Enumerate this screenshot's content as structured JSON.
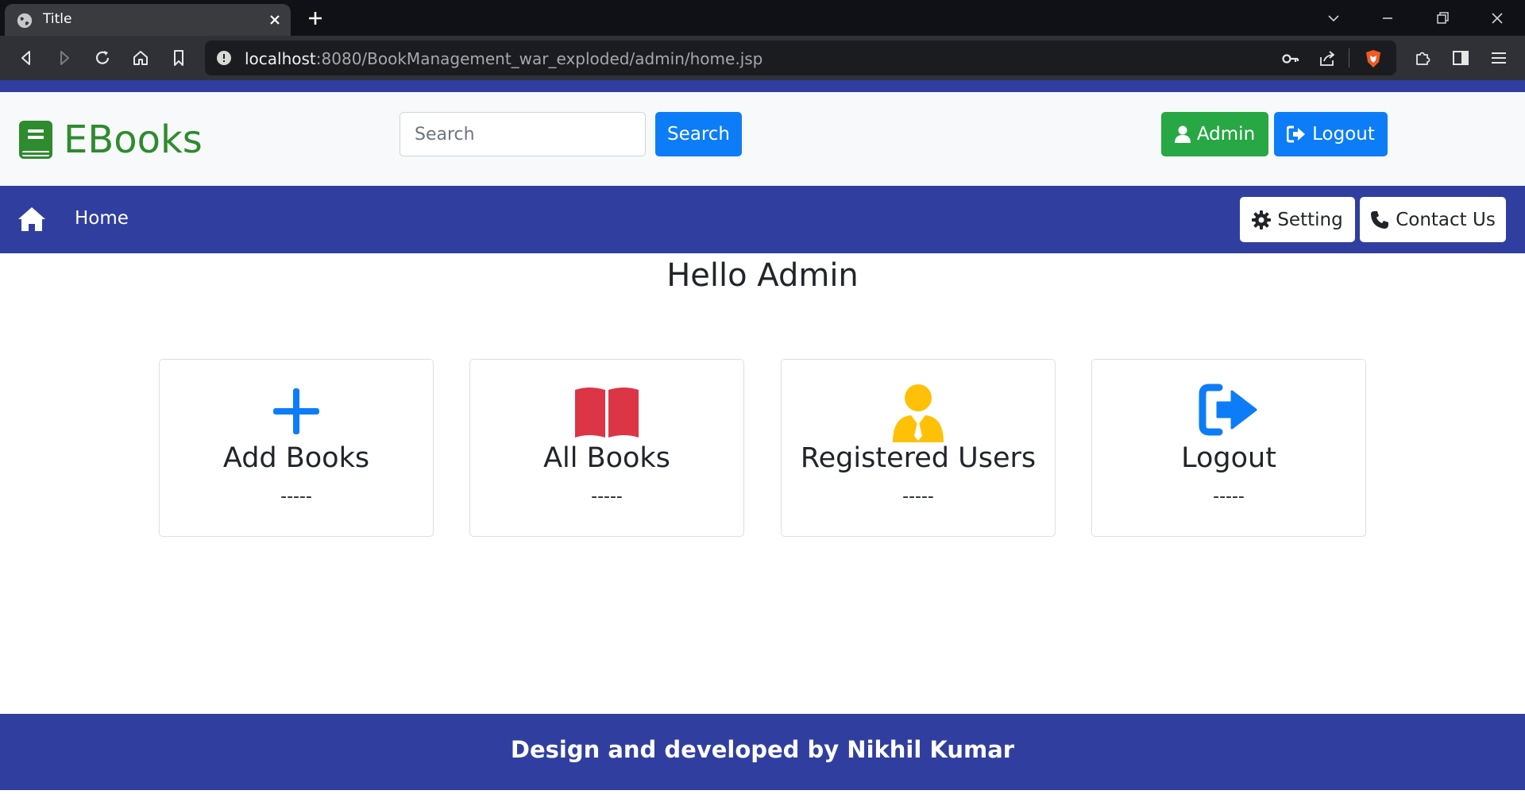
{
  "browser": {
    "tab_title": "Title",
    "url_host": "localhost",
    "url_rest": ":8080/BookManagement_war_exploded/admin/home.jsp",
    "icons": [
      "globe-icon",
      "close-icon",
      "plus-icon",
      "chevron-down-icon",
      "minimize-icon",
      "restore-icon",
      "window-close-icon",
      "back-icon",
      "forward-icon",
      "reload-icon",
      "home-icon",
      "bookmark-icon",
      "info-icon",
      "key-icon",
      "share-icon",
      "brave-shield-icon",
      "extensions-icon",
      "sidebar-icon",
      "menu-icon"
    ]
  },
  "header": {
    "brand": "EBooks",
    "search_placeholder": "Search",
    "search_button": "Search",
    "admin_button": "Admin",
    "logout_button": "Logout"
  },
  "navbar": {
    "home": "Home",
    "setting": "Setting",
    "contact": "Contact Us"
  },
  "main": {
    "greeting": "Hello Admin",
    "cards": [
      {
        "title": "Add Books",
        "sub": "-----",
        "icon": "plus-icon",
        "color": "#0d7df7"
      },
      {
        "title": "All Books",
        "sub": "-----",
        "icon": "open-book-icon",
        "color": "#dc3545"
      },
      {
        "title": "Registered Users",
        "sub": "-----",
        "icon": "user-tie-icon",
        "color": "#ffc107"
      },
      {
        "title": "Logout",
        "sub": "-----",
        "icon": "logout-icon",
        "color": "#0d7df7"
      }
    ]
  },
  "footer": {
    "text": "Design and developed by Nikhil Kumar"
  },
  "colors": {
    "brand_green": "#2e8b2e",
    "navbar_blue": "#303f9f",
    "primary": "#0d7df7",
    "success": "#28a745"
  }
}
